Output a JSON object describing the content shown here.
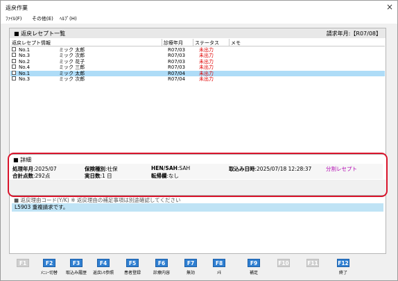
{
  "window": {
    "title": "返戻作業",
    "close": "×"
  },
  "menu": [
    "ﾌｧｲﾙ(F)",
    "その他(E)",
    "ﾍﾙﾌﾟ(H)"
  ],
  "list": {
    "header": "■ 返戻レセプト一覧",
    "billing_month": "請求年月:【R07/08】",
    "columns": [
      "返戻レセプト情報",
      "診療年月",
      "ステータス",
      "メモ"
    ],
    "rows": [
      {
        "no": "No.1",
        "name": "ミック 太郎",
        "ym": "R07/03",
        "status": "未出力",
        "selected": false
      },
      {
        "no": "No.3",
        "name": "ミック 次郎",
        "ym": "R07/03",
        "status": "未出力",
        "selected": false
      },
      {
        "no": "No.2",
        "name": "ミック 花子",
        "ym": "R07/03",
        "status": "未出力",
        "selected": false
      },
      {
        "no": "No.4",
        "name": "ミック 三郎",
        "ym": "R07/03",
        "status": "未出力",
        "selected": false
      },
      {
        "no": "No.1",
        "name": "ミック 太郎",
        "ym": "R07/04",
        "status": "未出力",
        "selected": true
      },
      {
        "no": "No.3",
        "name": "ミック 次郎",
        "ym": "R07/04",
        "status": "未出力",
        "selected": false
      }
    ]
  },
  "detail": {
    "header": "■ 詳細",
    "proc_ym_label": "処理年月",
    "proc_ym": ":2025/07",
    "ins_label": "保険種別",
    "ins": ":社保",
    "hen_label": "HEN/SAH",
    "hen": ":SAH",
    "import_label": "取込み日時",
    "import": ":2025/07/18 12:28:37",
    "split": "分割レセプト",
    "points_label": "合計点数",
    "points": ":292点",
    "days_label": "実日数",
    "days": ":1 日",
    "tenki_label": "転帰欄",
    "tenki": ":なし"
  },
  "reason": {
    "header": "■ 返戻理由コード(Y/K) ※ 返戻理由の補足事項は別途確認してください",
    "line": "L5903 重複請求です。"
  },
  "fkeys": [
    {
      "key": "F1",
      "label": "",
      "enabled": false
    },
    {
      "key": "F2",
      "label": "ﾒﾆｭｰ切替",
      "enabled": true
    },
    {
      "key": "F3",
      "label": "取込み履歴",
      "enabled": true
    },
    {
      "key": "F4",
      "label": "返戻ﾚｾ参照",
      "enabled": true
    },
    {
      "key": "F5",
      "label": "患者登録",
      "enabled": true
    },
    {
      "key": "F6",
      "label": "診療内容",
      "enabled": true
    },
    {
      "key": "F7",
      "label": "無効",
      "enabled": true
    },
    {
      "key": "F8",
      "label": "ﾒﾓ",
      "enabled": true
    },
    {
      "key": "F9",
      "label": "補足",
      "enabled": true
    },
    {
      "key": "F10",
      "label": "",
      "enabled": false
    },
    {
      "key": "F11",
      "label": "",
      "enabled": false
    },
    {
      "key": "F12",
      "label": "終了",
      "enabled": true
    }
  ],
  "colors": {
    "accent": "#2f7fd1",
    "status": "#e00000",
    "selected_row": "#aedcf7",
    "highlight": "#d9142b",
    "split": "#b000b0"
  }
}
